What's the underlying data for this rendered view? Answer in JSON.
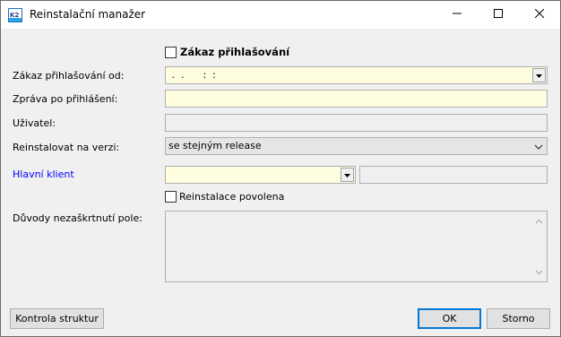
{
  "window": {
    "title": "Reinstalační manažer",
    "icon": "k2-app-icon",
    "controls": [
      "minimize-icon",
      "maximize-icon",
      "close-icon"
    ]
  },
  "form": {
    "disable_login_label": "Zákaz přihlašování",
    "disable_login_checked": false,
    "disable_from_label": "Zákaz přihlašování od:",
    "disable_from_value": " .  .      :  :",
    "message_label": "Zpráva po přihlášení:",
    "message_value": "",
    "user_label": "Uživatel:",
    "user_value": "",
    "reinstall_version_label": "Reinstalovat na verzi:",
    "reinstall_version_value": "se stejným release",
    "main_client_label": "Hlavní klient",
    "main_client_value": "",
    "main_client_name": "",
    "reinstall_allowed_label": "Reinstalace povolena",
    "reinstall_allowed_checked": false,
    "reasons_label": "Důvody nezaškrtnutí pole:",
    "reasons_value": ""
  },
  "buttons": {
    "check_structures": "Kontrola struktur",
    "ok": "OK",
    "cancel": "Storno"
  },
  "colors": {
    "required_field": "#fffde0",
    "link_label": "#0000ff",
    "default_button_border": "#0078d7"
  }
}
